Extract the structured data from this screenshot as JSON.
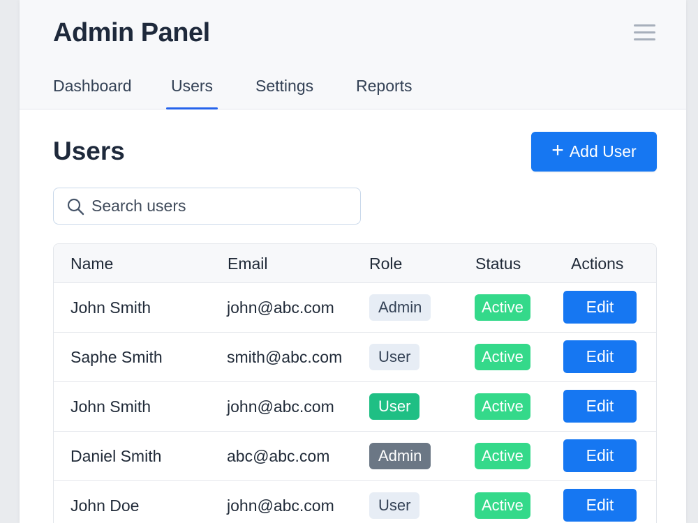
{
  "header": {
    "title": "Admin Panel",
    "menu_icon": "hamburger-menu-icon"
  },
  "tabs": [
    {
      "label": "Dashboard",
      "active": false
    },
    {
      "label": "Users",
      "active": true
    },
    {
      "label": "Settings",
      "active": false
    },
    {
      "label": "Reports",
      "active": false
    }
  ],
  "main": {
    "title": "Users",
    "add_button": {
      "icon": "plus-icon",
      "label": "Add User"
    },
    "search": {
      "icon": "search-icon",
      "placeholder": "Search users",
      "value": ""
    }
  },
  "table": {
    "columns": [
      "Name",
      "Email",
      "Role",
      "Status",
      "Actions"
    ],
    "rows": [
      {
        "name": "John Smith",
        "email": "john@abc.com",
        "role": "Admin",
        "role_style": "light",
        "status": "Active",
        "action": "Edit"
      },
      {
        "name": "Saphe Smith",
        "email": "smith@abc.com",
        "role": "User",
        "role_style": "light",
        "status": "Active",
        "action": "Edit"
      },
      {
        "name": "John Smith",
        "email": "john@abc.com",
        "role": "User",
        "role_style": "green",
        "status": "Active",
        "action": "Edit"
      },
      {
        "name": "Daniel Smith",
        "email": "abc@abc.com",
        "role": "Admin",
        "role_style": "dark",
        "status": "Active",
        "action": "Edit"
      },
      {
        "name": "John Doe",
        "email": "john@abc.com",
        "role": "User",
        "role_style": "light",
        "status": "Active",
        "action": "Edit"
      }
    ]
  },
  "colors": {
    "accent": "#1677f2",
    "tab_underline": "#2563eb",
    "status_active": "#34d98a",
    "role_green": "#1fbf84",
    "role_dark": "#6b7785",
    "role_light": "#e7edf5"
  }
}
